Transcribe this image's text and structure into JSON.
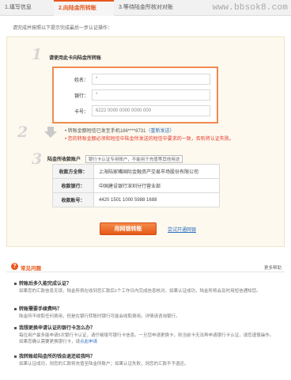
{
  "steps": [
    {
      "label": "1.填写信息"
    },
    {
      "label": "2.向陆金所转账"
    },
    {
      "label": "3.等待陆金所核对对账"
    }
  ],
  "watermark": "www.bbsok8.com",
  "intro": "请完成并按照以下提示完成最后一步认证操作：",
  "step_numbers": [
    "1",
    "2",
    "3"
  ],
  "section1": {
    "title": "请使用此卡向陆金所转账",
    "rows": [
      {
        "label": "姓名：",
        "value": "*"
      },
      {
        "label": "银行：",
        "value": "*"
      },
      {
        "label": "卡号：",
        "value": "6222 0000 0000 0000 000"
      }
    ]
  },
  "section2": {
    "sms_text": "• 转账金额短信已发至手机186****8731",
    "sms_link": "（重新发送）",
    "warning": "• 您的转账金额必须和短信中陆金所发送的短信中要求的一致，否则将认证失败。"
  },
  "section3": {
    "title": "陆金所收款账户",
    "badge": "银行卡认证专用账户，不能用于充值等其他用途",
    "note": "",
    "rows": [
      {
        "label": "收款方全称：",
        "value": "上海陆家嘴国际金融资产交易市场股份有限公司"
      },
      {
        "label": "收款银行：",
        "value": "中国建设银行深圳分行营业部"
      },
      {
        "label": "收款账号：",
        "value": "4420 1501 1000 5988 1688"
      }
    ]
  },
  "actions": {
    "primary": "用网银转账",
    "secondary": "尝试开通网银"
  },
  "faq": {
    "title": "常见问题",
    "more": "更多帮助",
    "items": [
      {
        "q": "转账后多久能完成认证？",
        "a": "如果您的汇款信息无误，陆金所将在收到您汇款后1个工作日内完成信息核对。如果认证成功，陆金所将会及时用短信通知您。",
        "link": ""
      },
      {
        "q": "转账需要手续费吗？",
        "a": "陆金所不收取任何费用，但是在银行转账时银行可能会收取费用，详情请咨询银行。",
        "link": ""
      },
      {
        "q": "我想更换申请认证的银行卡怎么办？",
        "a": "每位用户最多能申请5次银行卡认证，请仔细填写银行卡信息。一旦您申请更换卡，则当前卡无法再申请银行卡认证，请您谨慎操作。如果您确认需要更换银行卡，请",
        "link": "点此申请"
      },
      {
        "q": "我转账给陆金所的钱会退还给我吗？",
        "a": "如果认证成功，则您的汇款将充值至陆金所账户；如果认证失败，则您的汇款不予退还。",
        "link": ""
      }
    ]
  },
  "colors": {
    "accent": "#e8571c",
    "link": "#2e6fc1",
    "warning": "#e4392b",
    "panel_bg": "#fdf9ee"
  }
}
